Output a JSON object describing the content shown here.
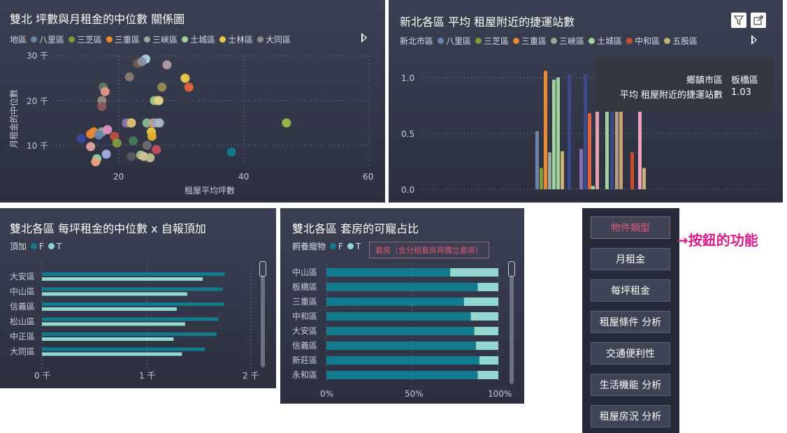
{
  "scatter": {
    "title": "雙北 坪數與月租金的中位數 關係圖",
    "legend_title": "地區",
    "legend": [
      {
        "name": "八里區",
        "color": "#6a85a8"
      },
      {
        "name": "三芝區",
        "color": "#7e9a3f"
      },
      {
        "name": "三重區",
        "color": "#ea8a34"
      },
      {
        "name": "三峽區",
        "color": "#9aa8a0"
      },
      {
        "name": "土城區",
        "color": "#9fd29c"
      },
      {
        "name": "士林區",
        "color": "#f0c94a"
      },
      {
        "name": "大同區",
        "color": "#8c8c92"
      }
    ],
    "x_ticks": [
      "20",
      "40",
      "60"
    ],
    "y_ticks": [
      "30 千",
      "20 千",
      "10 千"
    ],
    "xlabel": "租屋平均坪數",
    "ylabel": "月租金的中位數"
  },
  "bars_top": {
    "title": "新北各區 平均 租屋附近的捷運站數",
    "legend_title": "新北市區",
    "legend": [
      {
        "name": "八里區",
        "color": "#6a85a8"
      },
      {
        "name": "三芝區",
        "color": "#7e9a3f"
      },
      {
        "name": "三重區",
        "color": "#ea8a34"
      },
      {
        "name": "三峽區",
        "color": "#9aa8a0"
      },
      {
        "name": "土城區",
        "color": "#9fd29c"
      },
      {
        "name": "中和區",
        "color": "#c94f2f"
      },
      {
        "name": "五股區",
        "color": "#c9b27a"
      }
    ],
    "y_ticks": [
      "1.0",
      "0.5",
      "0.0"
    ],
    "tooltip": {
      "label1": "鄉鎮市區",
      "value1": "板橋區",
      "label2": "平均 租屋附近的捷運站數",
      "value2": "1.03"
    }
  },
  "hbar": {
    "title": "雙北各區 每坪租金的中位數 x 自報頂加",
    "legend_title": "頂加",
    "legend": [
      {
        "name": "F",
        "color": "#127b8e"
      },
      {
        "name": "T",
        "color": "#93d8ce"
      }
    ],
    "x_ticks": [
      "0 千",
      "1 千",
      "2 千"
    ]
  },
  "stacked": {
    "title": "雙北各區 套房的可寵占比",
    "legend_title": "飼養寵物",
    "legend": [
      {
        "name": "F",
        "color": "#127b8e"
      },
      {
        "name": "T",
        "color": "#93d8ce"
      }
    ],
    "badge": "套房（含分租套房與獨立套房）",
    "x_ticks": [
      "0%",
      "50%",
      "100%"
    ]
  },
  "buttons": [
    "物件類型",
    "月租金",
    "每坪租金",
    "租屋條件 分析",
    "交通便利性",
    "生活機能 分析",
    "租屋房況 分析"
  ],
  "annotation": "→按鈕的功能",
  "chart_data": [
    {
      "type": "scatter",
      "title": "雙北 坪數與月租金的中位數 關係圖",
      "xlabel": "租屋平均坪數",
      "ylabel": "月租金的中位數",
      "xlim": [
        10,
        60
      ],
      "ylim": [
        5,
        32
      ],
      "points": [
        {
          "x": 24.3,
          "y": 29.3,
          "c": "#a9d6ea"
        },
        {
          "x": 23.0,
          "y": 28.3,
          "c": "#7a5a4a"
        },
        {
          "x": 27.7,
          "y": 28.0,
          "c": "#b49aa8"
        },
        {
          "x": 23.7,
          "y": 28.7,
          "c": "#8a90a0"
        },
        {
          "x": 30.6,
          "y": 25.0,
          "c": "#f0c94a"
        },
        {
          "x": 31.2,
          "y": 23.0,
          "c": "#e0653f"
        },
        {
          "x": 21.7,
          "y": 25.3,
          "c": "#8a7a72"
        },
        {
          "x": 26.9,
          "y": 23.0,
          "c": "#9a8a55"
        },
        {
          "x": 17.5,
          "y": 23.0,
          "c": "#5f7a6a"
        },
        {
          "x": 17.8,
          "y": 22.0,
          "c": "#e09888"
        },
        {
          "x": 17.3,
          "y": 20.0,
          "c": "#9a8a82"
        },
        {
          "x": 17.3,
          "y": 18.7,
          "c": "#8c5a5a"
        },
        {
          "x": 26.2,
          "y": 20.0,
          "c": "#6a9ab8"
        },
        {
          "x": 25.7,
          "y": 20.0,
          "c": "#9cc488"
        },
        {
          "x": 26.4,
          "y": 20.0,
          "c": "#e8d08a"
        },
        {
          "x": 22.0,
          "y": 15.0,
          "c": "#e0a070"
        },
        {
          "x": 21.5,
          "y": 15.0,
          "c": "#a06050"
        },
        {
          "x": 21.2,
          "y": 15.0,
          "c": "#8a70b0"
        },
        {
          "x": 22.0,
          "y": 15.0,
          "c": "#d8c070"
        },
        {
          "x": 24.5,
          "y": 15.0,
          "c": "#8ab898"
        },
        {
          "x": 25.5,
          "y": 15.0,
          "c": "#d0a080"
        },
        {
          "x": 26.0,
          "y": 15.0,
          "c": "#90a8c8"
        },
        {
          "x": 26.5,
          "y": 15.0,
          "c": "#a8b8c0"
        },
        {
          "x": 46.8,
          "y": 15.0,
          "c": "#9ab84a"
        },
        {
          "x": 15.5,
          "y": 12.5,
          "c": "#ea8a34"
        },
        {
          "x": 16.0,
          "y": 13.0,
          "c": "#ea8a34"
        },
        {
          "x": 17.3,
          "y": 13.0,
          "c": "#9aa8a0"
        },
        {
          "x": 18.2,
          "y": 13.5,
          "c": "#e090c0"
        },
        {
          "x": 16.8,
          "y": 12.3,
          "c": "#6a85a8"
        },
        {
          "x": 19.3,
          "y": 12.0,
          "c": "#c05040"
        },
        {
          "x": 25.2,
          "y": 13.0,
          "c": "#f0c94a"
        },
        {
          "x": 25.3,
          "y": 12.0,
          "c": "#e8b030"
        },
        {
          "x": 14.0,
          "y": 11.5,
          "c": "#3a4aa0"
        },
        {
          "x": 19.7,
          "y": 10.5,
          "c": "#7e9a3f"
        },
        {
          "x": 22.3,
          "y": 11.0,
          "c": "#4a7a5a"
        },
        {
          "x": 15.5,
          "y": 9.7,
          "c": "#e8a0a0"
        },
        {
          "x": 24.5,
          "y": 10.0,
          "c": "#6a6a72"
        },
        {
          "x": 26.0,
          "y": 9.0,
          "c": "#c05060"
        },
        {
          "x": 18.0,
          "y": 8.0,
          "c": "#a0b0e0"
        },
        {
          "x": 22.0,
          "y": 7.5,
          "c": "#5a5a62"
        },
        {
          "x": 23.5,
          "y": 7.8,
          "c": "#9cc488"
        },
        {
          "x": 24.0,
          "y": 7.5,
          "c": "#d8c090"
        },
        {
          "x": 16.5,
          "y": 7.0,
          "c": "#8ad0a0"
        },
        {
          "x": 16.3,
          "y": 6.3,
          "c": "#f0a080"
        },
        {
          "x": 38.0,
          "y": 8.5,
          "c": "#127b8e"
        },
        {
          "x": 25.0,
          "y": 7.2,
          "c": "#c0c090"
        }
      ]
    },
    {
      "type": "bar",
      "title": "新北各區 平均 租屋附近的捷運站數",
      "ylim": [
        0,
        1.05
      ],
      "bars": [
        {
          "v": 0.52,
          "c": "#6a85a8"
        },
        {
          "v": 0.19,
          "c": "#7e9a3f"
        },
        {
          "v": 1.06,
          "c": "#ea8a34"
        },
        {
          "v": 0.33,
          "c": "#9aa8a0"
        },
        {
          "v": 0.98,
          "c": "#9fd29c"
        },
        {
          "v": 1.0,
          "c": "#9fd29c"
        },
        {
          "v": 0.34,
          "c": "#c9b27a"
        },
        {
          "v": 1.03,
          "c": "#3a4a8a"
        },
        {
          "v": 0.36,
          "c": "#8a70b0"
        },
        {
          "v": 1.03,
          "c": "#3a4a8a"
        },
        {
          "v": 0.68,
          "c": "#e0653f"
        },
        {
          "v": 0.03,
          "c": "#9fd29c"
        },
        {
          "v": 0.8,
          "c": "#e8a0b0"
        },
        {
          "v": 1.0,
          "c": "#9fd29c"
        },
        {
          "v": 0.73,
          "c": "#3a4a8a"
        },
        {
          "v": 1.02,
          "c": "#b49a88"
        },
        {
          "v": 0.78,
          "c": "#c9a070"
        },
        {
          "v": 0.33,
          "c": "#c94f2f"
        },
        {
          "v": 1.03,
          "c": "#f0a0c0"
        },
        {
          "v": 0.19,
          "c": "#c9b27a"
        }
      ]
    },
    {
      "type": "bar",
      "orientation": "horizontal",
      "title": "雙北各區 每坪租金的中位數 x 自報頂加",
      "xlim": [
        0,
        2000
      ],
      "categories": [
        "大安區",
        "中山區",
        "信義區",
        "松山區",
        "中正區",
        "大同區"
      ],
      "series": [
        {
          "name": "F",
          "values": [
            1750,
            1730,
            1740,
            1690,
            1670,
            1560
          ]
        },
        {
          "name": "T",
          "values": [
            1540,
            1390,
            1290,
            1370,
            1260,
            1340
          ]
        }
      ]
    },
    {
      "type": "bar",
      "orientation": "horizontal",
      "stacked": true,
      "title": "雙北各區 套房的可寵占比",
      "xlim": [
        0,
        100
      ],
      "categories": [
        "中山區",
        "板橋區",
        "三重區",
        "中和區",
        "大安區",
        "信義區",
        "新莊區",
        "永和區"
      ],
      "series": [
        {
          "name": "F",
          "values": [
            72,
            88,
            80,
            84,
            86,
            87,
            89,
            88
          ]
        },
        {
          "name": "T",
          "values": [
            28,
            12,
            20,
            16,
            14,
            13,
            11,
            12
          ]
        }
      ]
    }
  ]
}
